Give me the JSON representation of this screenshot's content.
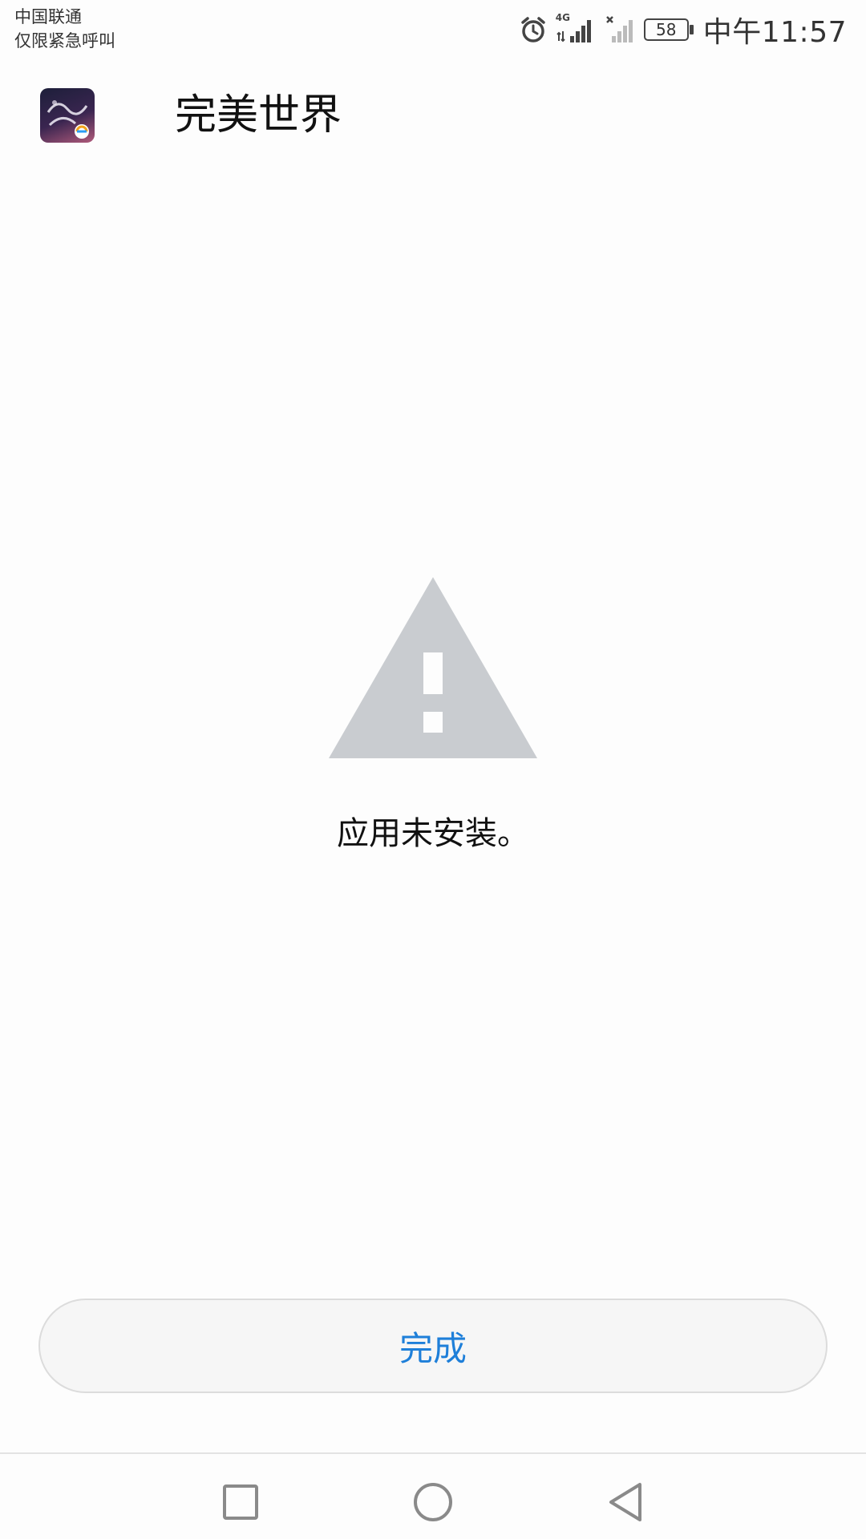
{
  "status_bar": {
    "carrier_line1": "中国联通",
    "carrier_line2": "仅限紧急呼叫",
    "network_type": "4G",
    "battery_level": "58",
    "time": "中午11:57"
  },
  "header": {
    "app_name": "完美世界",
    "icon": "app-icon"
  },
  "main": {
    "message": "应用未安装。",
    "icon": "warning-icon",
    "icon_color": "#c9ccd0"
  },
  "footer": {
    "done_label": "完成",
    "accent_color": "#1e7fd9"
  },
  "nav": {
    "recent": "recent-apps-icon",
    "home": "home-icon",
    "back": "back-icon"
  }
}
